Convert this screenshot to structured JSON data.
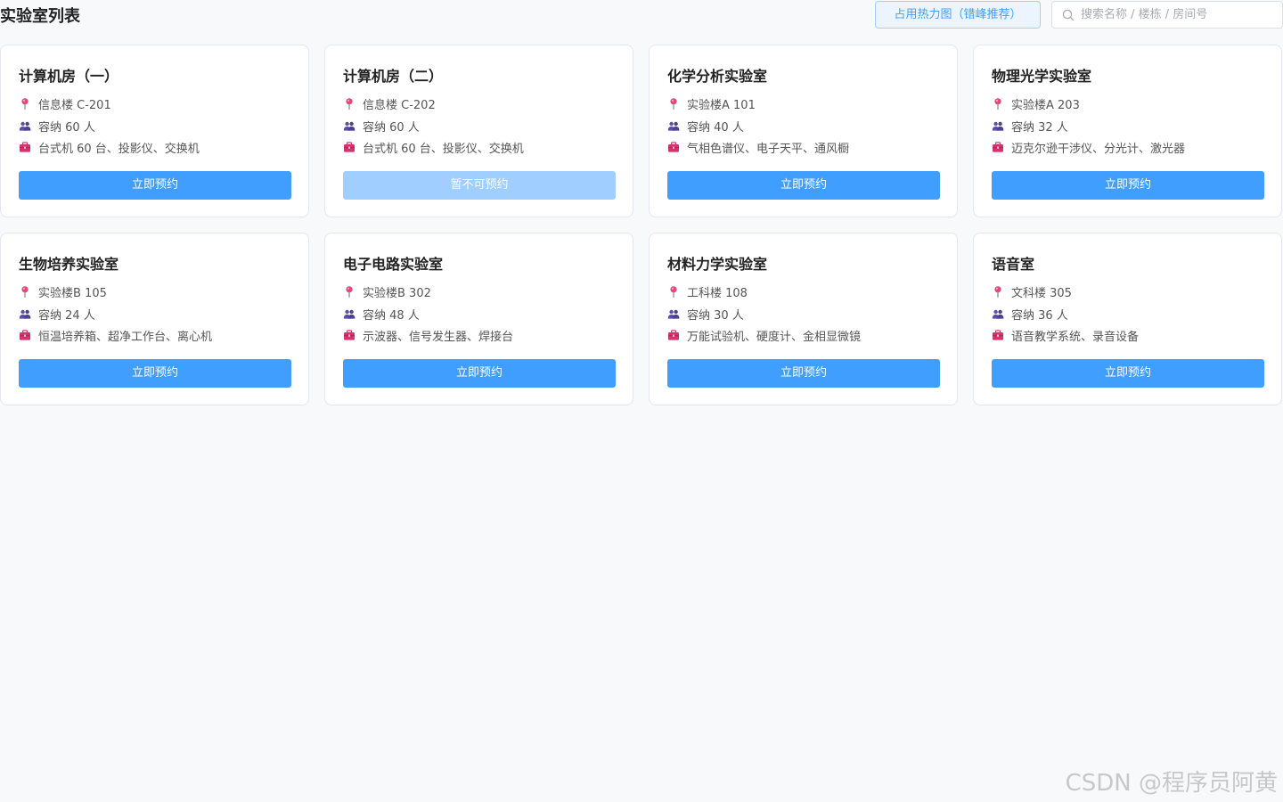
{
  "header": {
    "title": "实验室列表",
    "heatmap_button": "占用热力图（错峰推荐）",
    "search_placeholder": "搜索名称 / 楼栋 / 房间号",
    "search_value": ""
  },
  "labs": [
    {
      "name": "计算机房（一）",
      "location": "信息楼 C-201",
      "capacity": "容纳 60 人",
      "equipment": "台式机 60 台、投影仪、交换机",
      "button": "立即预约",
      "available": true
    },
    {
      "name": "计算机房（二）",
      "location": "信息楼 C-202",
      "capacity": "容纳 60 人",
      "equipment": "台式机 60 台、投影仪、交换机",
      "button": "暂不可预约",
      "available": false
    },
    {
      "name": "化学分析实验室",
      "location": "实验楼A 101",
      "capacity": "容纳 40 人",
      "equipment": "气相色谱仪、电子天平、通风橱",
      "button": "立即预约",
      "available": true
    },
    {
      "name": "物理光学实验室",
      "location": "实验楼A 203",
      "capacity": "容纳 32 人",
      "equipment": "迈克尔逊干涉仪、分光计、激光器",
      "button": "立即预约",
      "available": true
    },
    {
      "name": "生物培养实验室",
      "location": "实验楼B 105",
      "capacity": "容纳 24 人",
      "equipment": "恒温培养箱、超净工作台、离心机",
      "button": "立即预约",
      "available": true
    },
    {
      "name": "电子电路实验室",
      "location": "实验楼B 302",
      "capacity": "容纳 48 人",
      "equipment": "示波器、信号发生器、焊接台",
      "button": "立即预约",
      "available": true
    },
    {
      "name": "材料力学实验室",
      "location": "工科楼 108",
      "capacity": "容纳 30 人",
      "equipment": "万能试验机、硬度计、金相显微镜",
      "button": "立即预约",
      "available": true
    },
    {
      "name": "语音室",
      "location": "文科楼 305",
      "capacity": "容纳 36 人",
      "equipment": "语音教学系统、录音设备",
      "button": "立即预约",
      "available": true
    }
  ],
  "icons": {
    "location": "map-pin-icon",
    "capacity": "people-icon",
    "equipment": "toolbox-icon",
    "search": "search-icon"
  },
  "colors": {
    "primary": "#409eff",
    "primary_disabled": "#a0cfff",
    "pin": "#e8457a",
    "people": "#5b4fa8",
    "toolbox": "#d6336c",
    "background": "#f8f9fb"
  },
  "watermark": "CSDN @程序员阿黄"
}
